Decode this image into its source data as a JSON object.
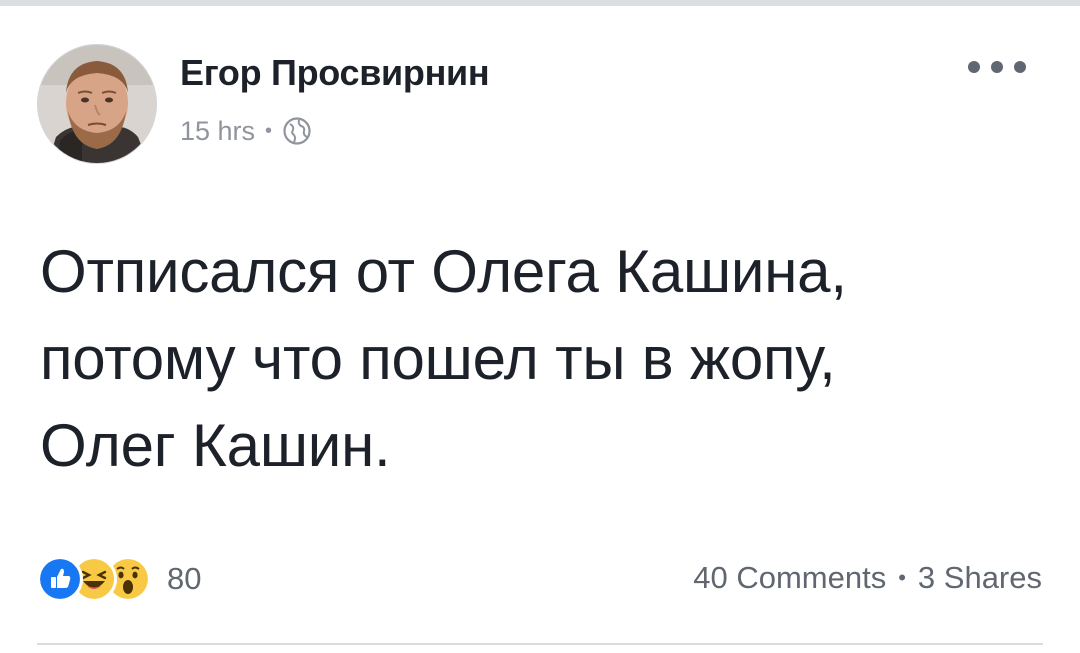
{
  "post": {
    "author": "Егор Просвирнин",
    "time": "15 hrs",
    "separator": "•",
    "privacy_icon": "globe-icon",
    "text_lines": [
      "Отписался от Олега Кашина,",
      "потому что пошел ты в жопу,",
      "Олег Кашин."
    ]
  },
  "reactions": {
    "icons": [
      "like-icon",
      "haha-icon",
      "wow-icon"
    ],
    "count": "80"
  },
  "stats": {
    "comments": "40 Comments",
    "separator": "•",
    "shares": "3 Shares"
  },
  "colors": {
    "like": "#1877f2",
    "emoji_yellow": "#f7c944",
    "text": "#1d2129",
    "muted": "#90949c"
  }
}
